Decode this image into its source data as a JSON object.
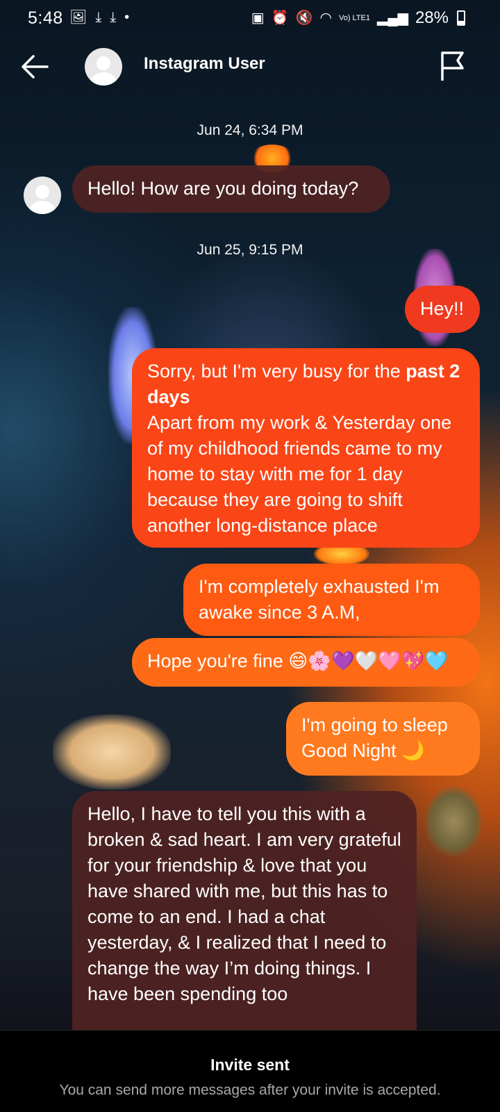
{
  "status_bar": {
    "time": "5:48",
    "left_icons": [
      "image-icon",
      "download-icon",
      "download-icon",
      "dot-icon"
    ],
    "battery_percent": "28%",
    "network_label": "Vo) LTE1"
  },
  "header": {
    "name": "Instagram User",
    "back_icon": "arrow-left-icon",
    "report_icon": "flag-icon"
  },
  "conversation": {
    "timestamps": [
      "Jun 24, 6:34 PM",
      "Jun 25, 9:15 PM"
    ],
    "messages": [
      {
        "from": "them",
        "text": "Hello! How are you doing today?"
      },
      {
        "from": "me",
        "text": "Hey!!"
      },
      {
        "from": "me",
        "text_a": "Sorry, but I'm very busy for the ",
        "text_bold": "past 2 days",
        "text_b": "Apart from my work & Yesterday one of my childhood friends came to my home to stay with me for 1 day because they are going to shift another long-distance place"
      },
      {
        "from": "me",
        "text": "I'm completely exhausted I'm awake since 3 A.M,"
      },
      {
        "from": "me",
        "text": "Hope you're fine 😄🌸💜🤍🩷💖🩵"
      },
      {
        "from": "me",
        "text_line1": "I'm going to sleep",
        "text_line2": "Good Night 🌙"
      },
      {
        "from": "them",
        "text": "Hello, I have to tell you this with a broken & sad heart. I am very grateful for your friendship & love that you have shared with me, but this has to come to an end. I had a chat yesterday, & I realized that I need to change the way I’m doing things. I have been spending too"
      }
    ]
  },
  "footer": {
    "title": "Invite sent",
    "subtitle": "You can send more messages after your invite is accepted."
  },
  "colors": {
    "received_bubble": "#502222",
    "sent_start": "#f03a1f",
    "sent_end": "#ff7a1f",
    "footer_bg": "#000000"
  }
}
